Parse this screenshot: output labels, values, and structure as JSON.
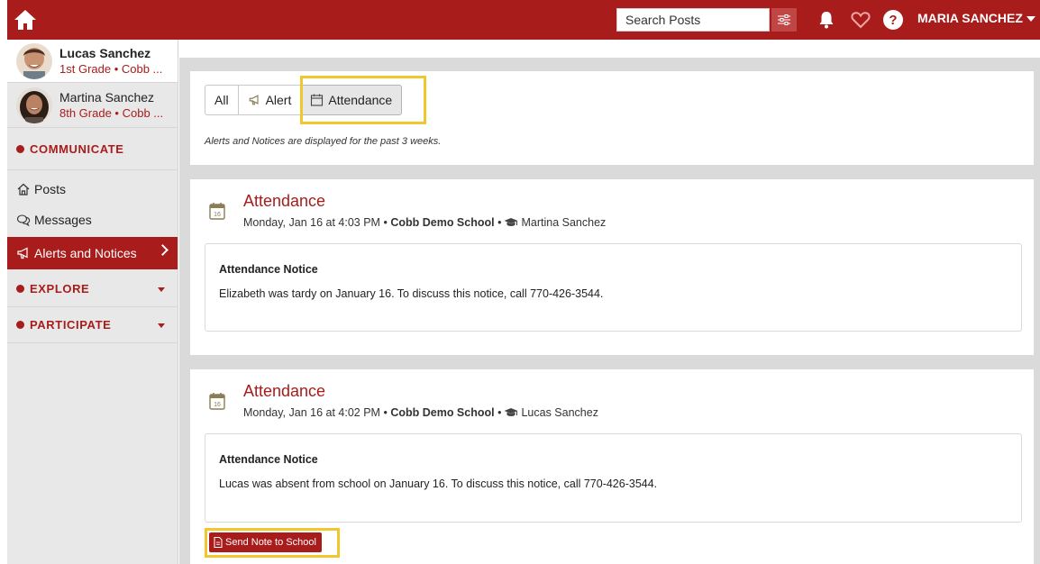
{
  "header": {
    "search_placeholder": "Search Posts",
    "user_name": "MARIA SANCHEZ",
    "help_glyph": "?"
  },
  "sidebar": {
    "children": [
      {
        "name": "Lucas Sanchez",
        "subtitle": "1st Grade • Cobb ..."
      },
      {
        "name": "Martina Sanchez",
        "subtitle": "8th Grade • Cobb ..."
      }
    ],
    "sections": {
      "communicate": "COMMUNICATE",
      "explore": "EXPLORE",
      "participate": "PARTICIPATE"
    },
    "nav": {
      "posts": "Posts",
      "messages": "Messages",
      "alerts": "Alerts and Notices"
    }
  },
  "filters": {
    "all": "All",
    "alert": "Alert",
    "attendance": "Attendance",
    "note": "Alerts and Notices are displayed for the past 3 weeks."
  },
  "posts": [
    {
      "title": "Attendance",
      "date": "Monday, Jan 16 at 4:03 PM",
      "school": "Cobb Demo School",
      "student": "Martina Sanchez",
      "calendar_day": "16",
      "notice_title": "Attendance Notice",
      "notice_body": "Elizabeth was tardy on January 16. To discuss this notice, call 770-426-3544."
    },
    {
      "title": "Attendance",
      "date": "Monday, Jan 16 at 4:02 PM",
      "school": "Cobb Demo School",
      "student": "Lucas Sanchez",
      "calendar_day": "16",
      "notice_title": "Attendance Notice",
      "notice_body": "Lucas was absent from school on January 16. To discuss this notice, call 770-426-3544.",
      "action_label": "Send Note to School"
    }
  ],
  "separators": {
    "dot": "•"
  },
  "colors": {
    "brand": "#a81c1c",
    "highlight": "#f2c62f",
    "sidebar_bg": "#e8e8e8",
    "main_bg": "#dadada"
  },
  "icons": {
    "home": "home-icon",
    "filter": "sliders-icon",
    "bell": "bell-icon",
    "heart": "heart-icon",
    "help": "question-icon",
    "posts": "house-outline-icon",
    "messages": "chat-bubbles-icon",
    "alerts": "megaphone-icon",
    "attendance": "calendar-icon",
    "student": "graduation-cap-icon",
    "note": "document-icon"
  }
}
